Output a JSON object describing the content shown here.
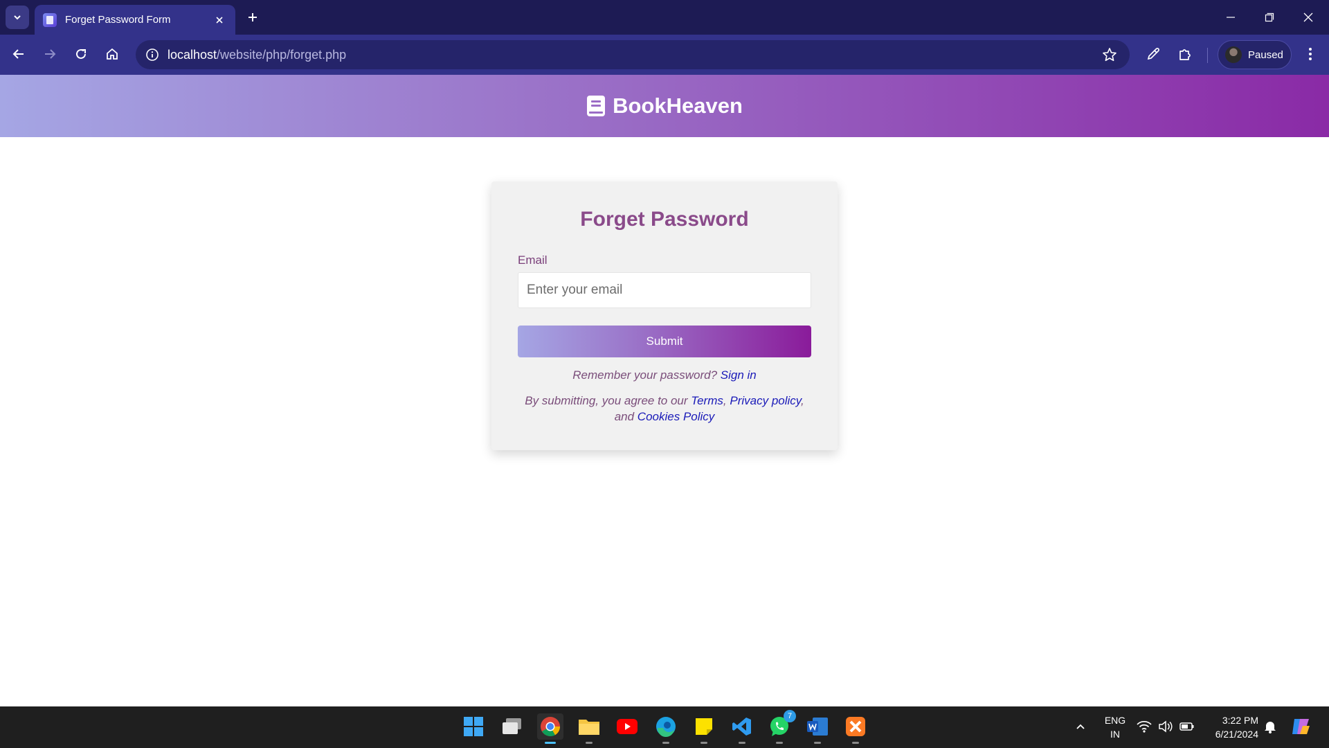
{
  "browser": {
    "tab_title": "Forget Password Form",
    "url_host": "localhost",
    "url_path": "/website/php/forget.php",
    "profile_label": "Paused"
  },
  "site": {
    "brand": "BookHeaven",
    "colors": {
      "header_start": "#a5a6e4",
      "header_end": "#8a2aa6",
      "title": "#8a4a8a",
      "link": "#1a1ab8"
    }
  },
  "form": {
    "title": "Forget Password",
    "email_label": "Email",
    "email_placeholder": "Enter your email",
    "submit_label": "Submit",
    "remember_text": "Remember your password?",
    "signin_link": "Sign in",
    "legal_prefix": "By submitting, you agree to our",
    "terms_link": "Terms",
    "comma1": ",",
    "privacy_link": "Privacy policy",
    "comma2": ",",
    "and_text": "and",
    "cookies_link": "Cookies Policy"
  },
  "taskbar": {
    "apps": [
      "windows-start",
      "task-view",
      "chrome",
      "file-explorer",
      "youtube",
      "edge",
      "sticky-notes",
      "vscode",
      "whatsapp",
      "word",
      "xampp"
    ],
    "whatsapp_badge": "7",
    "language_line1": "ENG",
    "language_line2": "IN",
    "time": "3:22 PM",
    "date": "6/21/2024"
  }
}
